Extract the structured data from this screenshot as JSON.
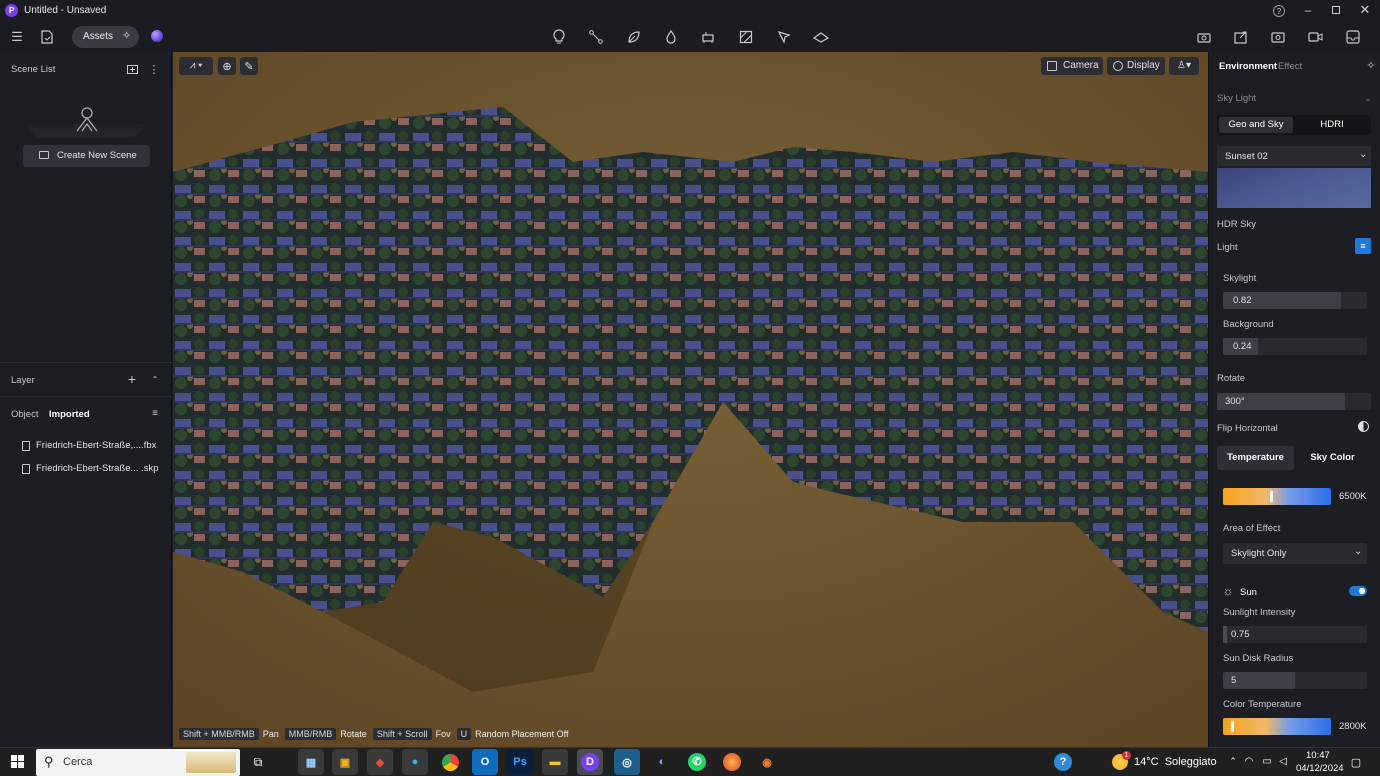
{
  "window": {
    "title": "Untitled - Unsaved"
  },
  "toolbar": {
    "assets_label": "Assets"
  },
  "scene_list": {
    "title": "Scene List",
    "create_button": "Create New Scene"
  },
  "layer": {
    "title": "Layer",
    "tabs": [
      "Object",
      "Imported"
    ],
    "items": [
      "Friedrich-Ebert-Straße,....fbx",
      "Friedrich-Ebert-Straße... .skp"
    ]
  },
  "viewport": {
    "camera_label": "Camera",
    "display_label": "Display",
    "hints": [
      {
        "key": "Shift + MMB/RMB",
        "action": "Pan"
      },
      {
        "key": "MMB/RMB",
        "action": "Rotate"
      },
      {
        "key": "Shift + Scroll",
        "action": "Fov"
      },
      {
        "key": "U",
        "action": "Random Placement Off"
      }
    ]
  },
  "panel": {
    "tabs": [
      "Environment",
      "Effect"
    ],
    "sky_light_label": "Sky Light",
    "sky_tabs": [
      "Geo and Sky",
      "HDRI"
    ],
    "hdri_selected": "Sunset 02",
    "hdr_sky_label": "HDR Sky",
    "light_label": "Light",
    "skylight_label": "Skylight",
    "skylight_value": "0.82",
    "skylight_level": 0.82,
    "background_label": "Background",
    "background_value": "0.24",
    "background_level": 0.24,
    "rotate_label": "Rotate",
    "rotate_value": "300°",
    "rotate_level": 0.83,
    "flip_label": "Flip Horizontal",
    "color_tabs": [
      "Temperature",
      "Sky Color"
    ],
    "temperature_value": "6500K",
    "area_label": "Area of Effect",
    "area_selected": "Skylight Only",
    "sun_label": "Sun",
    "sunlight_label": "Sunlight Intensity",
    "sunlight_value": "0.75",
    "sun_disk_label": "Sun Disk Radius",
    "sun_disk_value": "5",
    "color_temp_label": "Color Temperature",
    "color_temp_value": "2800K"
  },
  "taskbar": {
    "search_placeholder": "Cerca",
    "weather": "14°C  Soleggiato",
    "weather_badge": "1",
    "time": "10:47",
    "date": "04/12/2024"
  },
  "colors": {
    "accent": "#1f7bd8",
    "bg": "#1b1c21",
    "panel": "#1d1e23",
    "ground": "#6d5530"
  }
}
